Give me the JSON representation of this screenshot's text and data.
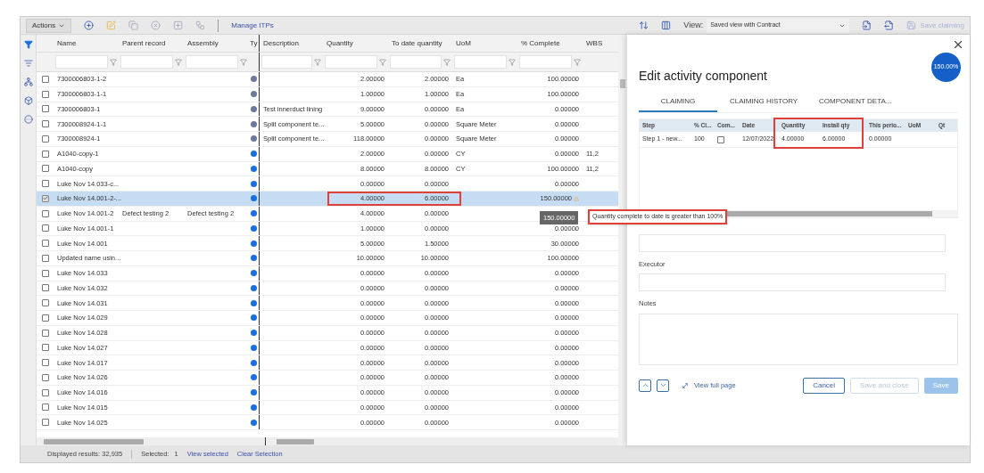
{
  "toolbar": {
    "actions": "Actions",
    "link": "Manage ITPs",
    "view_label": "View:",
    "view_value": "Saved view with Contract",
    "save": "Save claiming"
  },
  "columns": [
    "Name",
    "Parent record",
    "Assembly",
    "Ty",
    "Description",
    "Quantity",
    "To date quantity",
    "UoM",
    "% Complete",
    "WBS"
  ],
  "rows": [
    {
      "checked": false,
      "name": "7300006803-1-2",
      "parent": "",
      "assembly": "",
      "color": "#6b7a9c",
      "description": "",
      "quantity": "2.00000",
      "to_date": "2.00000",
      "uom": "Ea",
      "complete": "100.00000",
      "wbs": "",
      "selected": false,
      "flagged": false
    },
    {
      "checked": false,
      "name": "7300006803-1-1",
      "parent": "",
      "assembly": "",
      "color": "#6b7a9c",
      "description": "",
      "quantity": "1.00000",
      "to_date": "1.00000",
      "uom": "Ea",
      "complete": "100.00000",
      "wbs": "",
      "selected": false,
      "flagged": false
    },
    {
      "checked": false,
      "name": "7300006803-1",
      "parent": "",
      "assembly": "",
      "color": "#6b7a9c",
      "description": "Test innerduct lining",
      "quantity": "9.00000",
      "to_date": "0.00000",
      "uom": "Ea",
      "complete": "0.00000",
      "wbs": "",
      "selected": false,
      "flagged": false
    },
    {
      "checked": false,
      "name": "7300008924-1-1",
      "parent": "",
      "assembly": "",
      "color": "#6b7a9c",
      "description": "Split component te...",
      "quantity": "5.00000",
      "to_date": "0.00000",
      "uom": "Square Meter",
      "complete": "0.00000",
      "wbs": "",
      "selected": false,
      "flagged": false
    },
    {
      "checked": false,
      "name": "7300008924-1",
      "parent": "",
      "assembly": "",
      "color": "#6b7a9c",
      "description": "Split component te...",
      "quantity": "118.00000",
      "to_date": "0.00000",
      "uom": "Square Meter",
      "complete": "0.00000",
      "wbs": "",
      "selected": false,
      "flagged": false
    },
    {
      "checked": false,
      "name": "A1040-copy-1",
      "parent": "",
      "assembly": "",
      "color": "#1a6fe0",
      "description": "",
      "quantity": "2.00000",
      "to_date": "0.00000",
      "uom": "CY",
      "complete": "0.00000",
      "wbs": "11,2",
      "selected": false,
      "flagged": false
    },
    {
      "checked": false,
      "name": "A1040-copy",
      "parent": "",
      "assembly": "",
      "color": "#1a6fe0",
      "description": "",
      "quantity": "8.00000",
      "to_date": "8.00000",
      "uom": "CY",
      "complete": "100.00000",
      "wbs": "11,2",
      "selected": false,
      "flagged": false
    },
    {
      "checked": false,
      "name": "Luke Nov 14.033-c...",
      "parent": "",
      "assembly": "",
      "color": "#1a6fe0",
      "description": "",
      "quantity": "0.00000",
      "to_date": "0.00000",
      "uom": "",
      "complete": "0.00000",
      "wbs": "",
      "selected": false,
      "flagged": false
    },
    {
      "checked": true,
      "name": "Luke Nov 14.001-2-...",
      "parent": "",
      "assembly": "",
      "color": "#1a6fe0",
      "description": "",
      "quantity": "4.00000",
      "to_date": "6.00000",
      "uom": "",
      "complete": "150.00000",
      "wbs": "",
      "selected": true,
      "flagged": true
    },
    {
      "checked": false,
      "name": "Luke Nov 14.001-2",
      "parent": "Defect testing 2",
      "assembly": "Defect testing 2",
      "color": "#1a6fe0",
      "description": "",
      "quantity": "4.00000",
      "to_date": "0.00000",
      "uom": "",
      "complete": "",
      "wbs": "",
      "selected": false,
      "flagged": false
    },
    {
      "checked": false,
      "name": "Luke Nov 14.001-1",
      "parent": "",
      "assembly": "",
      "color": "#1a6fe0",
      "description": "",
      "quantity": "1.00000",
      "to_date": "0.00000",
      "uom": "",
      "complete": "0.00000",
      "wbs": "",
      "selected": false,
      "flagged": false
    },
    {
      "checked": false,
      "name": "Luke Nov 14.001",
      "parent": "",
      "assembly": "",
      "color": "#1a6fe0",
      "description": "",
      "quantity": "5.00000",
      "to_date": "1.50000",
      "uom": "",
      "complete": "30.00000",
      "wbs": "",
      "selected": false,
      "flagged": false
    },
    {
      "checked": false,
      "name": "Updated name usin...",
      "parent": "",
      "assembly": "",
      "color": "#1a6fe0",
      "description": "",
      "quantity": "10.00000",
      "to_date": "10.00000",
      "uom": "",
      "complete": "100.00000",
      "wbs": "",
      "selected": false,
      "flagged": false
    },
    {
      "checked": false,
      "name": "Luke Nov 14.033",
      "parent": "",
      "assembly": "",
      "color": "#1a6fe0",
      "description": "",
      "quantity": "0.00000",
      "to_date": "0.00000",
      "uom": "",
      "complete": "0.00000",
      "wbs": "",
      "selected": false,
      "flagged": false
    },
    {
      "checked": false,
      "name": "Luke Nov 14.032",
      "parent": "",
      "assembly": "",
      "color": "#1a6fe0",
      "description": "",
      "quantity": "0.00000",
      "to_date": "0.00000",
      "uom": "",
      "complete": "0.00000",
      "wbs": "",
      "selected": false,
      "flagged": false
    },
    {
      "checked": false,
      "name": "Luke Nov 14.031",
      "parent": "",
      "assembly": "",
      "color": "#1a6fe0",
      "description": "",
      "quantity": "0.00000",
      "to_date": "0.00000",
      "uom": "",
      "complete": "0.00000",
      "wbs": "",
      "selected": false,
      "flagged": false
    },
    {
      "checked": false,
      "name": "Luke Nov 14.029",
      "parent": "",
      "assembly": "",
      "color": "#1a6fe0",
      "description": "",
      "quantity": "0.00000",
      "to_date": "0.00000",
      "uom": "",
      "complete": "0.00000",
      "wbs": "",
      "selected": false,
      "flagged": false
    },
    {
      "checked": false,
      "name": "Luke Nov 14.028",
      "parent": "",
      "assembly": "",
      "color": "#1a6fe0",
      "description": "",
      "quantity": "0.00000",
      "to_date": "0.00000",
      "uom": "",
      "complete": "0.00000",
      "wbs": "",
      "selected": false,
      "flagged": false
    },
    {
      "checked": false,
      "name": "Luke Nov 14.027",
      "parent": "",
      "assembly": "",
      "color": "#1a6fe0",
      "description": "",
      "quantity": "0.00000",
      "to_date": "0.00000",
      "uom": "",
      "complete": "0.00000",
      "wbs": "",
      "selected": false,
      "flagged": false
    },
    {
      "checked": false,
      "name": "Luke Nov 14.017",
      "parent": "",
      "assembly": "",
      "color": "#1a6fe0",
      "description": "",
      "quantity": "0.00000",
      "to_date": "0.00000",
      "uom": "",
      "complete": "0.00000",
      "wbs": "",
      "selected": false,
      "flagged": false
    },
    {
      "checked": false,
      "name": "Luke Nov 14.026",
      "parent": "",
      "assembly": "",
      "color": "#1a6fe0",
      "description": "",
      "quantity": "0.00000",
      "to_date": "0.00000",
      "uom": "",
      "complete": "0.00000",
      "wbs": "",
      "selected": false,
      "flagged": false
    },
    {
      "checked": false,
      "name": "Luke Nov 14.016",
      "parent": "",
      "assembly": "",
      "color": "#1a6fe0",
      "description": "",
      "quantity": "0.00000",
      "to_date": "0.00000",
      "uom": "",
      "complete": "0.00000",
      "wbs": "",
      "selected": false,
      "flagged": false
    },
    {
      "checked": false,
      "name": "Luke Nov 14.015",
      "parent": "",
      "assembly": "",
      "color": "#1a6fe0",
      "description": "",
      "quantity": "0.00000",
      "to_date": "0.00000",
      "uom": "",
      "complete": "0.00000",
      "wbs": "",
      "selected": false,
      "flagged": false
    },
    {
      "checked": false,
      "name": "Luke Nov 14.025",
      "parent": "",
      "assembly": "",
      "color": "#1a6fe0",
      "description": "",
      "quantity": "0.00000",
      "to_date": "0.00000",
      "uom": "",
      "complete": "0.00000",
      "wbs": "",
      "selected": false,
      "flagged": false
    }
  ],
  "tooltip": {
    "value": "150.00000",
    "message": "Quantity complete to date is greater than 100%"
  },
  "status_bar": {
    "results": "Displayed results: 32,935",
    "selected_label": "Selected:",
    "selected_count": "1",
    "links": [
      "View selected",
      "Clear Selection"
    ]
  },
  "panel": {
    "badge": "150.00%",
    "title": "Edit activity component",
    "tabs": [
      {
        "label": "CLAIMING",
        "selected": true
      },
      {
        "label": "CLAIMING HISTORY",
        "selected": false
      },
      {
        "label": "COMPONENT DETA...",
        "selected": false
      }
    ],
    "table": {
      "columns": [
        "Step",
        "% Cl...",
        "Com...",
        "Date",
        "Quantity",
        "Install qty",
        "This perio...",
        "UoM",
        "Qt"
      ],
      "rows": [
        {
          "step": "Step 1 - new...",
          "percent": "100",
          "completed": false,
          "date": "12/07/2022",
          "quantity": "4.00000",
          "install_qty": "6.00000",
          "this_period": "0.00000",
          "uom": ""
        }
      ]
    },
    "fields": [
      {
        "kind": "input"
      },
      {
        "kind": "input",
        "label": "Executor"
      },
      {
        "kind": "textarea",
        "label": "Notes"
      }
    ],
    "link": "View full page",
    "buttons": [
      {
        "label": "Cancel",
        "kind": "outline",
        "disabled": false
      },
      {
        "label": "Save and close",
        "kind": "outline",
        "disabled": true
      },
      {
        "label": "Save",
        "kind": "primary",
        "disabled": true
      }
    ]
  }
}
